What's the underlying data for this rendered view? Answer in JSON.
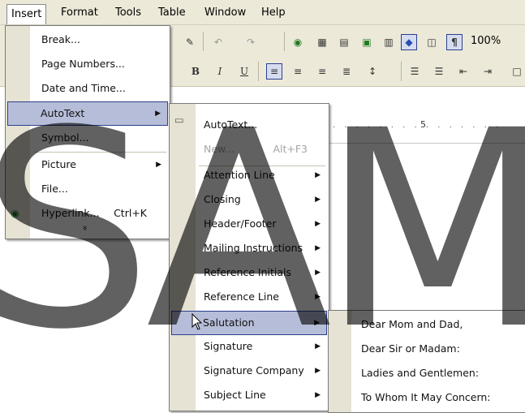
{
  "menubar": {
    "items": [
      {
        "label": "Insert"
      },
      {
        "label": "Format"
      },
      {
        "label": "Tools"
      },
      {
        "label": "Table"
      },
      {
        "label": "Window"
      },
      {
        "label": "Help"
      }
    ]
  },
  "toolbar": {
    "zoom": "100%",
    "bold": "B",
    "italic": "I",
    "underline": "U",
    "paragraph_mark": "¶"
  },
  "ruler": {
    "number": "5"
  },
  "insert_menu": {
    "items": [
      {
        "label": "Break..."
      },
      {
        "label": "Page Numbers..."
      },
      {
        "label": "Date and Time..."
      },
      {
        "label": "AutoText"
      },
      {
        "label": "Symbol..."
      },
      {
        "label": "Picture"
      },
      {
        "label": "File..."
      },
      {
        "label": "Hyperlink...",
        "shortcut": "Ctrl+K"
      }
    ],
    "expand_glyph": "»"
  },
  "autotext_menu": {
    "items": [
      {
        "label": "AutoText..."
      },
      {
        "label": "New...",
        "shortcut": "Alt+F3"
      },
      {
        "label": "Attention Line"
      },
      {
        "label": "Closing"
      },
      {
        "label": "Header/Footer"
      },
      {
        "label": "Mailing Instructions"
      },
      {
        "label": "Reference Initials"
      },
      {
        "label": "Reference Line"
      },
      {
        "label": "Salutation"
      },
      {
        "label": "Signature"
      },
      {
        "label": "Signature Company"
      },
      {
        "label": "Subject Line"
      }
    ]
  },
  "salutation_menu": {
    "items": [
      {
        "label": "Dear Mom and Dad,"
      },
      {
        "label": "Dear Sir or Madam:"
      },
      {
        "label": "Ladies and Gentlemen:"
      },
      {
        "label": "To Whom It May Concern:"
      }
    ]
  },
  "watermark": "SAM",
  "colors": {
    "highlight": "#b6bdd8",
    "highlight_border": "#2d3f8e",
    "menubar": "#ece9d8"
  }
}
